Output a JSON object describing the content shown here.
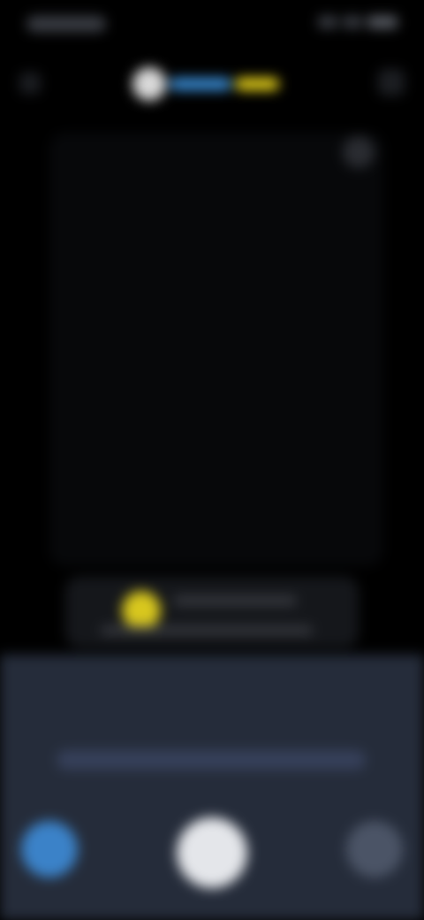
{
  "colors": {
    "background": "#000000",
    "panel": "#252c3a",
    "accent_blue": "#3a8dd6",
    "accent_yellow": "#e7d21a",
    "shutter": "#e4e6ea"
  },
  "icons": {
    "back": "back-icon",
    "menu": "menu-icon",
    "flash": "flash-icon",
    "hint": "lightbulb-icon",
    "gallery": "gallery-icon",
    "shutter": "shutter-icon",
    "switch": "switch-camera-icon"
  }
}
